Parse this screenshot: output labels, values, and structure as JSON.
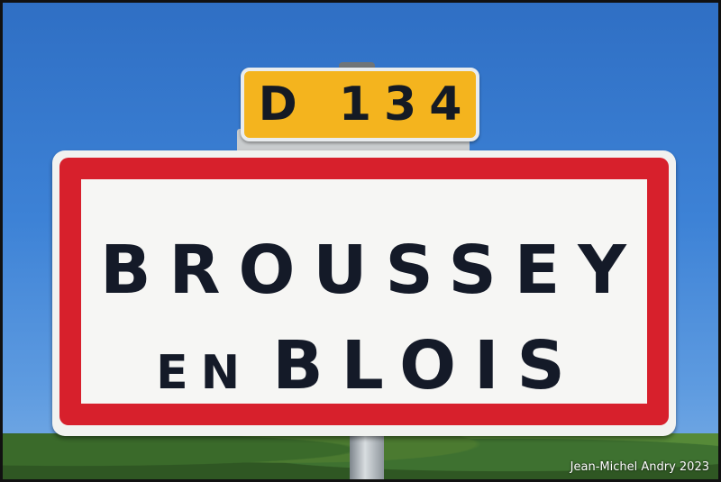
{
  "route_plate": {
    "label": "D 134"
  },
  "town_sign": {
    "line1": "BROUSSEY",
    "line2_small": "EN",
    "line2_big": "BLOIS"
  },
  "photo_credit": "Jean-Michel Andry 2023",
  "colors": {
    "sky": "#3d82d6",
    "plate_yellow": "#f4b41e",
    "sign_red": "#d7202c",
    "sign_text": "#141a28"
  }
}
